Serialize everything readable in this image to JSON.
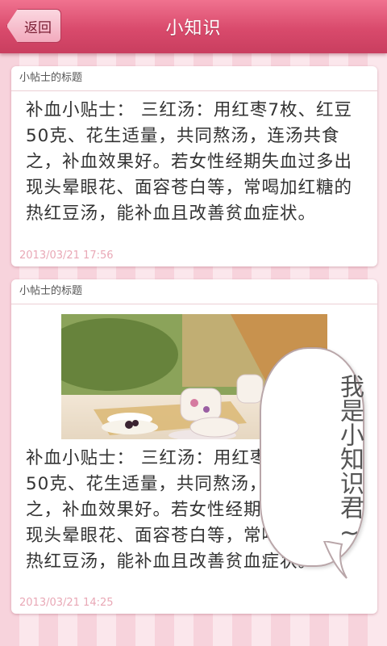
{
  "header": {
    "back_label": "返回",
    "title": "小知识"
  },
  "cards": [
    {
      "title": "小帖士的标题",
      "body": "补血小贴士： 三红汤：用红枣7枚、红豆50克、花生适量，共同熬汤，连汤共食之，补血效果好。若女性经期失血过多出现头晕眼花、面容苍白等，常喝加红糖的热红豆汤，能补血且改善贫血症状。",
      "time": "2013/03/21   17:56"
    },
    {
      "title": "小帖士的标题",
      "image": "tea-set-photo",
      "body": "补血小贴士： 三红汤：用红枣7枚、红豆50克、花生适量，共同熬汤，连汤共食之，补血效果好。若女性经期失血过多出现头晕眼花、面容苍白等，常喝加红糖的热红豆汤，能补血且改善贫血症状。",
      "time": "2013/03/21   14:25"
    }
  ],
  "bubble": {
    "text": "我是小知识君~"
  },
  "colors": {
    "header_pink": "#d94a6c",
    "stripe_light": "#fbe7ec",
    "stripe_dark": "#f7d3dc",
    "timestamp": "#e9a8b6"
  }
}
